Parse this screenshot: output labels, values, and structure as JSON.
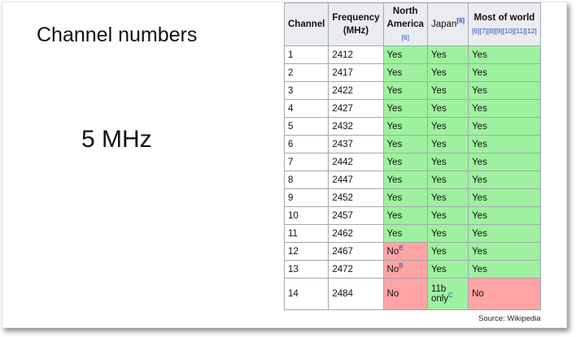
{
  "slide": {
    "title": "Channel numbers",
    "bandwidth_label": "5 MHz",
    "source": "Source: Wikipedia"
  },
  "table": {
    "headers": {
      "channel": "Channel",
      "frequency_line1": "Frequency",
      "frequency_line2": "(MHz)",
      "north_america_line1": "North",
      "north_america_line2": "America",
      "north_america_ref": "[6]",
      "japan": "Japan",
      "japan_ref": "[6]",
      "world": "Most of world",
      "world_refs": "[6][7][8][9][10][11][12]"
    },
    "rows": [
      {
        "channel": "1",
        "freq": "2412",
        "na": "Yes",
        "japan": "Yes",
        "world": "Yes"
      },
      {
        "channel": "2",
        "freq": "2417",
        "na": "Yes",
        "japan": "Yes",
        "world": "Yes"
      },
      {
        "channel": "3",
        "freq": "2422",
        "na": "Yes",
        "japan": "Yes",
        "world": "Yes"
      },
      {
        "channel": "4",
        "freq": "2427",
        "na": "Yes",
        "japan": "Yes",
        "world": "Yes"
      },
      {
        "channel": "5",
        "freq": "2432",
        "na": "Yes",
        "japan": "Yes",
        "world": "Yes"
      },
      {
        "channel": "6",
        "freq": "2437",
        "na": "Yes",
        "japan": "Yes",
        "world": "Yes"
      },
      {
        "channel": "7",
        "freq": "2442",
        "na": "Yes",
        "japan": "Yes",
        "world": "Yes"
      },
      {
        "channel": "8",
        "freq": "2447",
        "na": "Yes",
        "japan": "Yes",
        "world": "Yes"
      },
      {
        "channel": "9",
        "freq": "2452",
        "na": "Yes",
        "japan": "Yes",
        "world": "Yes"
      },
      {
        "channel": "10",
        "freq": "2457",
        "na": "Yes",
        "japan": "Yes",
        "world": "Yes"
      },
      {
        "channel": "11",
        "freq": "2462",
        "na": "Yes",
        "japan": "Yes",
        "world": "Yes"
      },
      {
        "channel": "12",
        "freq": "2467",
        "na": "No",
        "na_note": "B",
        "japan": "Yes",
        "world": "Yes"
      },
      {
        "channel": "13",
        "freq": "2472",
        "na": "No",
        "na_note": "B",
        "japan": "Yes",
        "world": "Yes"
      },
      {
        "channel": "14",
        "freq": "2484",
        "na": "No",
        "japan_line1": "11b",
        "japan_line2": "only",
        "japan_note": "C",
        "world": "No"
      }
    ],
    "colors": {
      "yes": "#9ef19e",
      "no": "#ffa4a4",
      "header": "#eaecf0",
      "link": "#2a4ec0"
    }
  }
}
